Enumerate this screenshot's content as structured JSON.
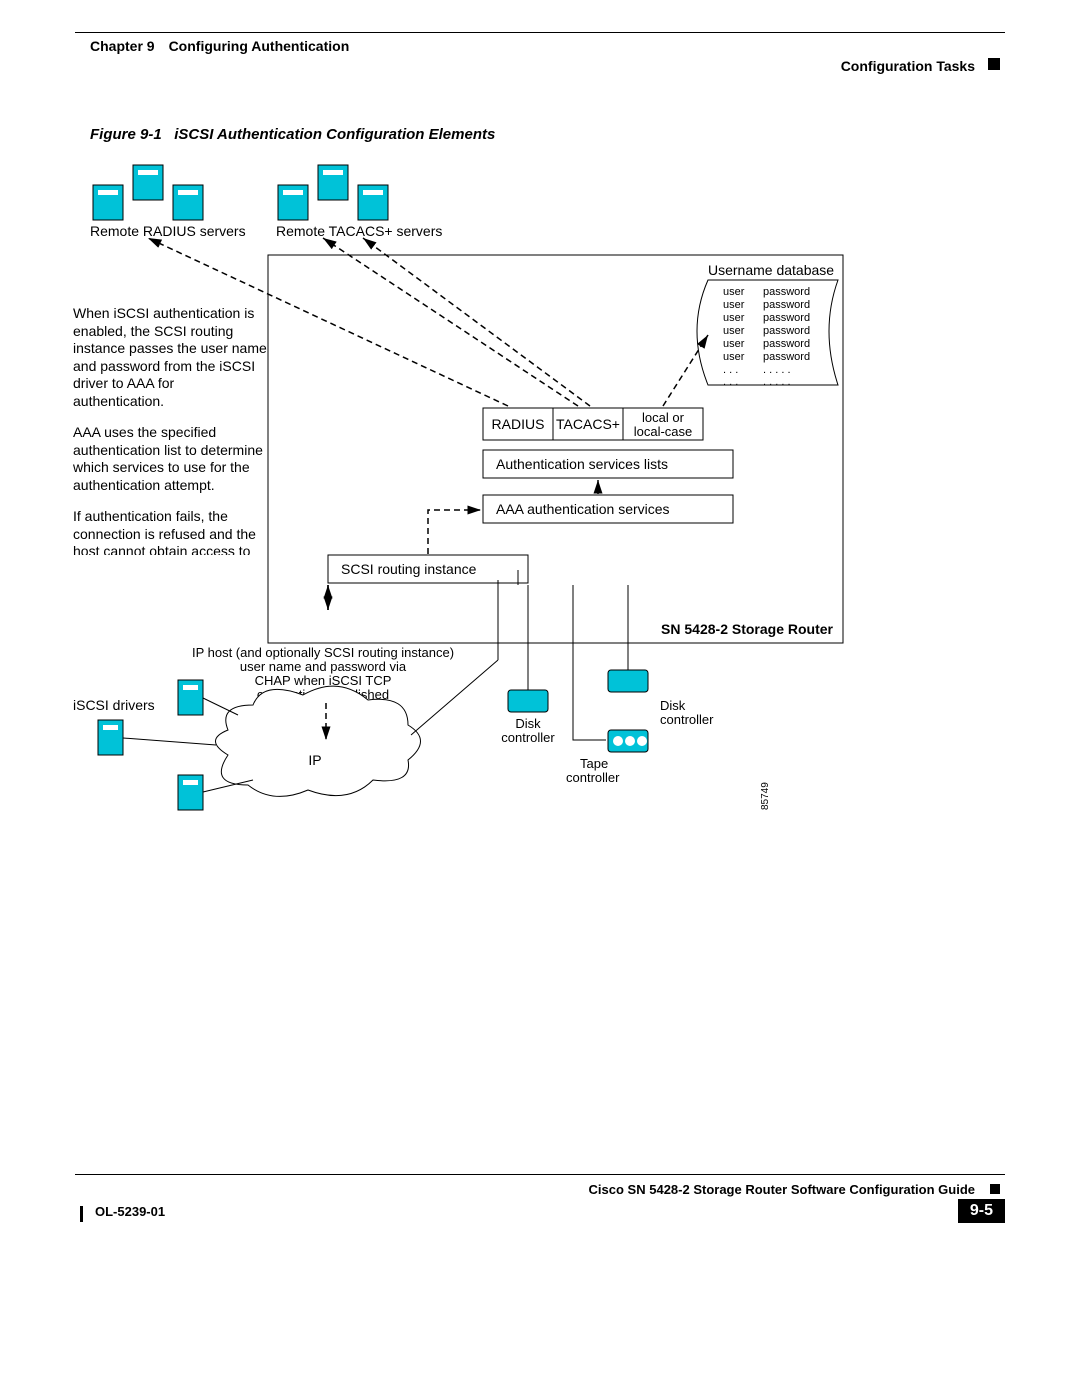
{
  "header": {
    "chapter": "Chapter 9 Configuring Authentication",
    "section": "Configuration Tasks"
  },
  "figure": {
    "number": "Figure 9-1",
    "title": "iSCSI Authentication Configuration Elements",
    "remote_radius": "Remote RADIUS servers",
    "remote_tacacs": "Remote TACACS+ servers",
    "username_db": "Username database",
    "db_rows": [
      [
        "user",
        "password"
      ],
      [
        "user",
        "password"
      ],
      [
        "user",
        "password"
      ],
      [
        "user",
        "password"
      ],
      [
        "user",
        "password"
      ],
      [
        "user",
        "password"
      ],
      [
        ". . .",
        ". . . . ."
      ],
      [
        ". . .",
        ". . . . ."
      ]
    ],
    "para1": "When iSCSI authentication is enabled, the SCSI routing instance passes the user name and password from the iSCSI driver to AAA for authentication.",
    "para2": "AAA uses the specified authentication list to determine which services to use for the authentication attempt.",
    "para3": "If authentication fails, the connection is refused and the host cannot obtain access to storage resources.",
    "radius": "RADIUS",
    "tacacs": "TACACS+",
    "local": "local or\nlocal-case",
    "auth_services_lists": "Authentication services lists",
    "aaa_services": "AAA authentication services",
    "scsi_routing": "SCSI routing instance",
    "storage_router": "SN 5428-2 Storage Router",
    "ip_host_lines": [
      "IP host (and optionally SCSI routing instance)",
      "user name and password via",
      "CHAP when iSCSI TCP",
      "connection established"
    ],
    "iscsi_drivers": "iSCSI drivers",
    "ip_cloud": "IP",
    "disk1": "Disk\ncontroller",
    "disk2": "Disk\ncontroller",
    "tape": "Tape\ncontroller",
    "figure_ref": "85749"
  },
  "footer": {
    "book": "Cisco SN 5428-2 Storage Router Software Configuration Guide",
    "doc": "OL-5239-01",
    "page": "9-5"
  }
}
